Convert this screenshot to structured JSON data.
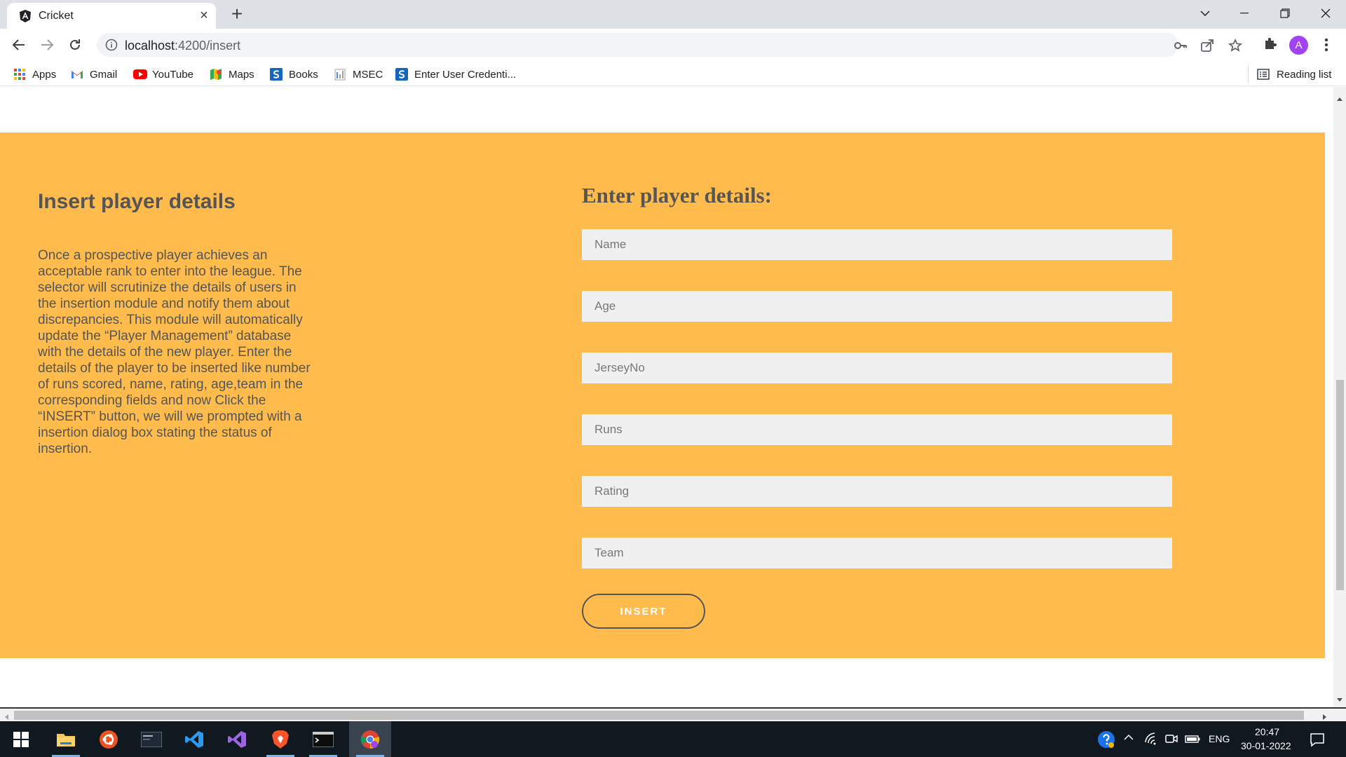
{
  "browser": {
    "tab_title": "Cricket",
    "url_host": "localhost",
    "url_rest": ":4200/insert",
    "bookmarks": [
      {
        "label": "Apps",
        "icon": "apps-grid-icon"
      },
      {
        "label": "Gmail",
        "icon": "gmail-icon"
      },
      {
        "label": "YouTube",
        "icon": "youtube-icon"
      },
      {
        "label": "Maps",
        "icon": "maps-icon"
      },
      {
        "label": "Books",
        "icon": "books-icon"
      },
      {
        "label": "MSEC",
        "icon": "msec-icon"
      },
      {
        "label": "Enter User Credenti...",
        "icon": "credentials-icon"
      }
    ],
    "reading_list": "Reading list",
    "avatar_letter": "A"
  },
  "page": {
    "info": {
      "title": "Insert player details",
      "text": "Once a prospective player achieves an acceptable rank to enter into the league. The selector will scrutinize the details of users in the insertion module and notify them about discrepancies. This module will automatically update the “Player Management” database with the details of the new player. Enter the details of the player to be inserted like number of runs scored, name, rating, age,team in the corresponding fields and now Click the “INSERT” button, we will we prompted with a insertion dialog box stating the status of insertion."
    },
    "form": {
      "title": "Enter player details:",
      "fields": {
        "name": {
          "placeholder": "Name",
          "value": ""
        },
        "age": {
          "placeholder": "Age",
          "value": ""
        },
        "jersey": {
          "placeholder": "JerseyNo",
          "value": ""
        },
        "runs": {
          "placeholder": "Runs",
          "value": ""
        },
        "rating": {
          "placeholder": "Rating",
          "value": ""
        },
        "team": {
          "placeholder": "Team",
          "value": ""
        }
      },
      "submit_label": "INSERT"
    }
  },
  "taskbar": {
    "time": "20:47",
    "date": "30-01-2022",
    "language": "ENG"
  },
  "colors": {
    "band": "#ffbc4d",
    "text": "#555555",
    "field_bg": "#f0f0f0",
    "avatar": "#a142f4",
    "taskbar": "#101820"
  }
}
